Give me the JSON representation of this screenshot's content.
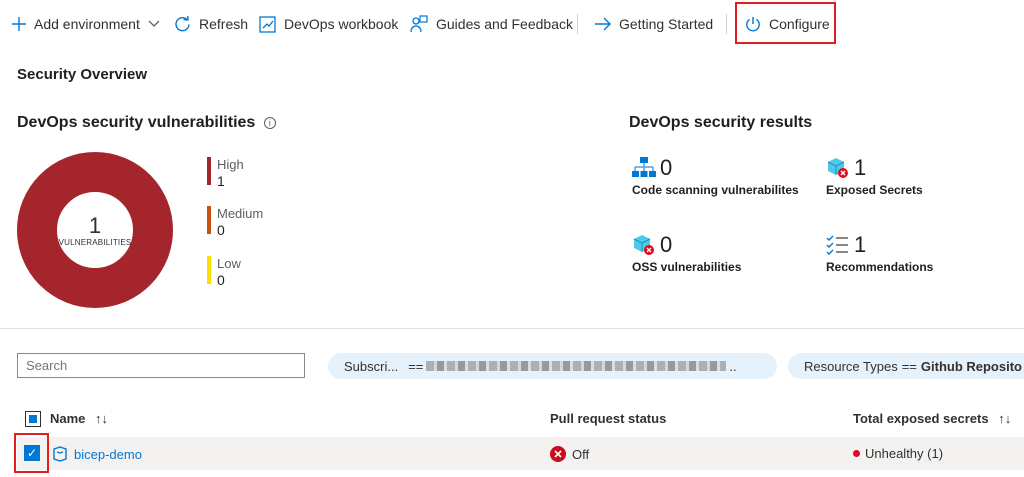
{
  "toolbar": {
    "add_environment": "Add environment",
    "refresh": "Refresh",
    "workbook": "DevOps workbook",
    "guides": "Guides and Feedback",
    "getting_started": "Getting Started",
    "configure": "Configure"
  },
  "section_title": "Security Overview",
  "vulnerabilities": {
    "title": "DevOps security vulnerabilities",
    "info_icon": "i",
    "total": "1",
    "total_label": "VULNERABILITIES",
    "legend": [
      {
        "name": "High",
        "value": "1",
        "color": "#a4262c"
      },
      {
        "name": "Medium",
        "value": "0",
        "color": "#ca5010"
      },
      {
        "name": "Low",
        "value": "0",
        "color": "#fce100"
      }
    ]
  },
  "results": {
    "title": "DevOps security results",
    "items": [
      {
        "value": "0",
        "label": "Code scanning vulnerabilites",
        "icon": "code-scanning-icon"
      },
      {
        "value": "1",
        "label": "Exposed Secrets",
        "icon": "exposed-secrets-icon"
      },
      {
        "value": "0",
        "label": "OSS vulnerabilities",
        "icon": "oss-icon"
      },
      {
        "value": "1",
        "label": "Recommendations",
        "icon": "recommendations-icon"
      }
    ]
  },
  "filters": {
    "search_placeholder": "Search",
    "subscription_label": "Subscri...",
    "subscription_op": "==",
    "subscription_tail": "..",
    "resource_label": "Resource Types",
    "resource_op": "==",
    "resource_value": "Github Reposito"
  },
  "table": {
    "columns": [
      "Name",
      "Pull request status",
      "Total exposed secrets"
    ],
    "sort_glyph": "↑↓",
    "rows": [
      {
        "name": "bicep-demo",
        "pr_status": "Off",
        "secrets": "Unhealthy (1)"
      }
    ]
  },
  "colors": {
    "accent": "#0078d4",
    "highlight_box": "#e02020",
    "high": "#a4262c"
  }
}
